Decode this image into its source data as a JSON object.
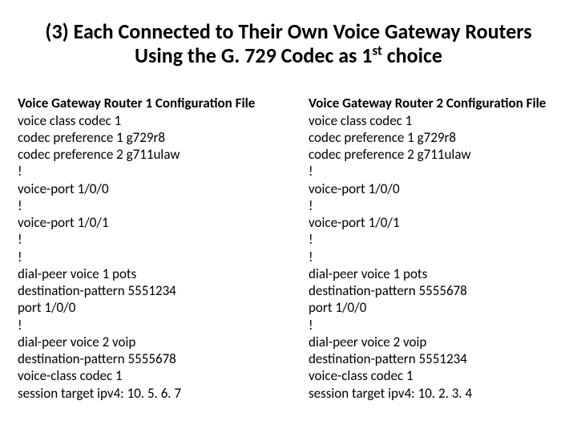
{
  "title_html": "(3) Each Connected to Their Own Voice Gateway Routers Using the G. 729 Codec  as 1<sup>st</sup> choice",
  "left": {
    "header": "Voice Gateway Router 1 Configuration File",
    "lines": [
      "voice class codec 1",
      "codec preference 1 g729r8",
      "codec preference 2 g711ulaw",
      "!",
      "voice-port 1/0/0",
      "!",
      "voice-port 1/0/1",
      "!",
      "!",
      "dial-peer voice 1 pots",
      "destination-pattern 5551234",
      "port 1/0/0",
      "!",
      "dial-peer voice 2 voip",
      "destination-pattern 5555678",
      "voice-class codec 1",
      "session target ipv4: 10. 5. 6. 7"
    ]
  },
  "right": {
    "header": "Voice Gateway Router 2 Configuration File",
    "lines": [
      "voice class codec 1",
      "codec preference 1 g729r8",
      "codec preference 2 g711ulaw",
      "!",
      "voice-port 1/0/0",
      "!",
      "voice-port 1/0/1",
      "!",
      "!",
      "dial-peer voice 1 pots",
      "destination-pattern 5555678",
      "port 1/0/0",
      "!",
      "dial-peer voice 2 voip",
      "destination-pattern 5551234",
      "voice-class codec 1",
      "session target ipv4: 10. 2. 3. 4"
    ]
  }
}
